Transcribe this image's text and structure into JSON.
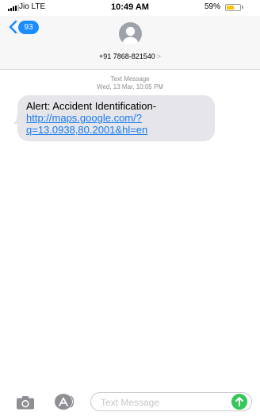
{
  "status_bar": {
    "carrier": "Jio  LTE",
    "time": "10:49 AM",
    "battery_percent": "59%",
    "battery_level": 0.59,
    "battery_color": "#f7c600"
  },
  "header": {
    "back_badge_count": "93",
    "contact_number": "+91 7868-821540",
    "contact_chevron": ">",
    "accent_color": "#1a8cff"
  },
  "conversation": {
    "meta_type": "Text Message",
    "meta_datetime": "Wed, 13 Mar, 10:05 PM",
    "messages": [
      {
        "direction": "incoming",
        "text": "Alert: Accident Identification-",
        "link": "http://maps.google.com/?q=13.0938,80.2001&hl=en",
        "link_line1": "http://maps.google.com/?",
        "link_line2": "q=13.0938,80.2001&hl=en"
      }
    ]
  },
  "input_bar": {
    "placeholder": "Text Message",
    "icons": [
      "camera-icon",
      "app-store-icon",
      "send-arrow-icon"
    ],
    "send_color": "#34c759"
  }
}
